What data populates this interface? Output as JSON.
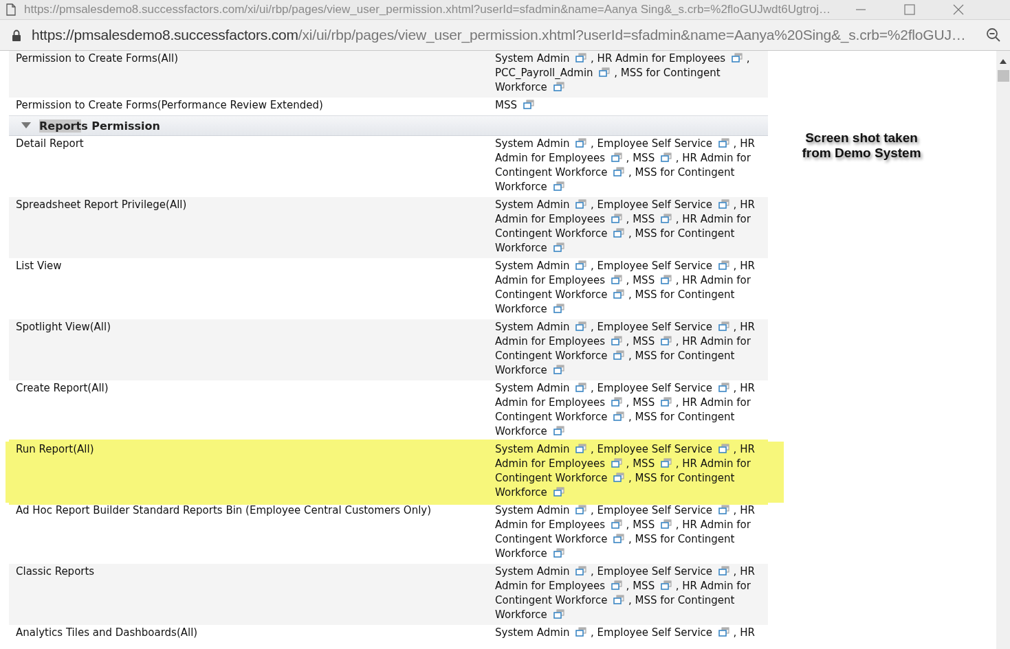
{
  "browser": {
    "title_url": "https://pmsalesdemo8.successfactors.com/xi/ui/rbp/pages/view_user_permission.xhtml?userId=sfadmin&name=Aanya Sing&_s.crb=%2floGUJwdt6Ugtroj…",
    "address_host": "https://pmsalesdemo8.successfactors.com",
    "address_path": "/xi/ui/rbp/pages/view_user_permission.xhtml?userId=sfadmin&name=Aanya%20Sing&_s.crb=%2floGUJ…"
  },
  "separator": ",",
  "rows": [
    {
      "kind": "row",
      "name": "Permission to Create Forms(All)",
      "roles": [
        "System Admin",
        "HR Admin for Employees",
        "PCC_Payroll_Admin",
        "MSS for Contingent Workforce"
      ],
      "highlighted": false,
      "cut": false
    },
    {
      "kind": "row",
      "name": "Permission to Create Forms(Performance Review Extended)",
      "roles": [
        "MSS"
      ],
      "highlighted": false,
      "cut": false
    },
    {
      "kind": "section",
      "title_marked": "Report",
      "title_rest": "s Permission",
      "expanded": true
    },
    {
      "kind": "row",
      "name": "Detail Report",
      "roles": [
        "System Admin",
        "Employee Self Service",
        "HR Admin for Employees",
        "MSS",
        "HR Admin for Contingent Workforce",
        "MSS for Contingent Workforce"
      ],
      "highlighted": false,
      "cut": false
    },
    {
      "kind": "row",
      "name": "Spreadsheet Report Privilege(All)",
      "roles": [
        "System Admin",
        "Employee Self Service",
        "HR Admin for Employees",
        "MSS",
        "HR Admin for Contingent Workforce",
        "MSS for Contingent Workforce"
      ],
      "highlighted": false,
      "cut": false
    },
    {
      "kind": "row",
      "name": "List View",
      "roles": [
        "System Admin",
        "Employee Self Service",
        "HR Admin for Employees",
        "MSS",
        "HR Admin for Contingent Workforce",
        "MSS for Contingent Workforce"
      ],
      "highlighted": false,
      "cut": false
    },
    {
      "kind": "row",
      "name": "Spotlight View(All)",
      "roles": [
        "System Admin",
        "Employee Self Service",
        "HR Admin for Employees",
        "MSS",
        "HR Admin for Contingent Workforce",
        "MSS for Contingent Workforce"
      ],
      "highlighted": false,
      "cut": false
    },
    {
      "kind": "row",
      "name": "Create Report(All)",
      "roles": [
        "System Admin",
        "Employee Self Service",
        "HR Admin for Employees",
        "MSS",
        "HR Admin for Contingent Workforce",
        "MSS for Contingent Workforce"
      ],
      "highlighted": false,
      "cut": false
    },
    {
      "kind": "row",
      "name": "Run Report(All)",
      "roles": [
        "System Admin",
        "Employee Self Service",
        "HR Admin for Employees",
        "MSS",
        "HR Admin for Contingent Workforce",
        "MSS for Contingent Workforce"
      ],
      "highlighted": true,
      "cut": false
    },
    {
      "kind": "row",
      "name": "Ad Hoc Report Builder Standard Reports Bin (Employee Central Customers Only)",
      "roles": [
        "System Admin",
        "Employee Self Service",
        "HR Admin for Employees",
        "MSS",
        "HR Admin for Contingent Workforce",
        "MSS for Contingent Workforce"
      ],
      "highlighted": false,
      "cut": false
    },
    {
      "kind": "row",
      "name": "Classic Reports",
      "roles": [
        "System Admin",
        "Employee Self Service",
        "HR Admin for Employees",
        "MSS",
        "HR Admin for Contingent Workforce",
        "MSS for Contingent Workforce"
      ],
      "highlighted": false,
      "cut": false
    },
    {
      "kind": "row",
      "name": "Analytics Tiles and Dashboards(All)",
      "roles": [
        "System Admin",
        "Employee Self Service",
        "HR"
      ],
      "highlighted": false,
      "cut": true
    }
  ],
  "annotation": "Screen shot taken from Demo System"
}
